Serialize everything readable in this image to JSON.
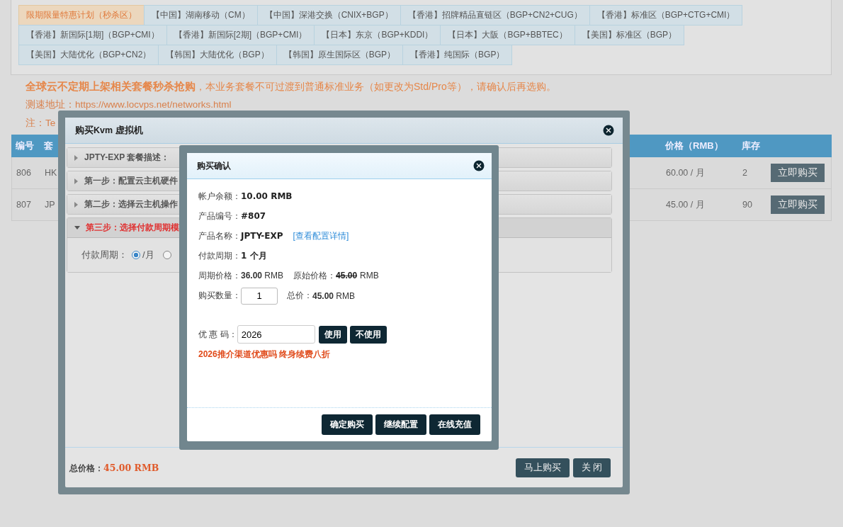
{
  "tabs": [
    {
      "label": "限期限量特惠计划（秒杀区）",
      "selected": true
    },
    {
      "label": "【中国】湖南移动（CM）",
      "selected": false
    },
    {
      "label": "【中国】深港交换（CNIX+BGP）",
      "selected": false
    },
    {
      "label": "【香港】招牌精品直链区（BGP+CN2+CUG）",
      "selected": false
    },
    {
      "label": "【香港】标准区（BGP+CTG+CMI）",
      "selected": false
    },
    {
      "label": "【香港】新国际[1期]（BGP+CMI）",
      "selected": false
    },
    {
      "label": "【香港】新国际[2期]（BGP+CMI）",
      "selected": false
    },
    {
      "label": "【日本】东京（BGP+KDDI）",
      "selected": false
    },
    {
      "label": "【日本】大阪（BGP+BBTEC）",
      "selected": false
    },
    {
      "label": "【美国】标准区（BGP）",
      "selected": false
    },
    {
      "label": "【美国】大陆优化（BGP+CN2）",
      "selected": false
    },
    {
      "label": "【韩国】大陆优化（BGP）",
      "selected": false
    },
    {
      "label": "【韩国】原生国际区（BGP）",
      "selected": false
    },
    {
      "label": "【香港】纯国际（BGP）",
      "selected": false
    }
  ],
  "notice": "**全球云不定期上架相关套餐秒杀抢购**，本业务套餐不可过渡到普通标准业务（如更改为Std/Pro等），请确认后再选购。",
  "speed_test": "测速地址：https://www.locvps.net/networks.html",
  "note": "注：Te",
  "table": {
    "columns": [
      "编号",
      "套",
      "价格（RMB）",
      "库存"
    ],
    "rows": [
      {
        "id": "806",
        "name": "HK",
        "price": "60.00 / 月",
        "stock": "2",
        "action": "立即购买"
      },
      {
        "id": "807",
        "name": "JP",
        "price": "45.00 / 月",
        "stock": "90",
        "action": "立即购买"
      }
    ]
  },
  "kvm_dialog": {
    "title": "购买Kvm 虚拟机",
    "steps": [
      {
        "label": "JPTY-EXP 套餐描述：",
        "expanded": false
      },
      {
        "label": "第一步：配置云主机硬件",
        "expanded": false
      },
      {
        "label": "第二步：选择云主机操作",
        "expanded": false
      },
      {
        "label": "第三步：选择付款周期模",
        "expanded": true
      }
    ],
    "payment_period": {
      "label": "付款周期：",
      "options": [
        {
          "label": "/月",
          "selected": true
        },
        {
          "selected": false
        }
      ]
    },
    "total_label": "总价格：",
    "total": "45.00 RMB",
    "buttons": [
      "马上购买",
      "关 闭"
    ]
  },
  "confirm_dialog": {
    "title": "购买确认",
    "balance": {
      "label": "帐户余额：",
      "value": "10.00 RMB"
    },
    "product_id": {
      "label": "产品编号：",
      "value": "#807"
    },
    "product_name": {
      "label": "产品名称：",
      "value": "JPTY-EXP",
      "link": "[查看配置详情]"
    },
    "period": {
      "label": "付款周期：",
      "value": "1 个月"
    },
    "price": {
      "label": "周期价格：",
      "value": "**36.00** RMB",
      "original_label": "原始价格：",
      "original": "45.00",
      "original_unit": "RMB"
    },
    "quantity": {
      "label": "购买数量：",
      "value": "1",
      "total_label": "总价：",
      "total": "**45.00** RMB"
    },
    "coupon": {
      "label": "优 惠 码：",
      "value": "2026",
      "buttons": [
        "使用",
        "不使用"
      ]
    },
    "promo": "2026推介渠道优惠吗 终身续费八折",
    "buttons": [
      "确定购买",
      "继续配置",
      "在线充值"
    ]
  }
}
